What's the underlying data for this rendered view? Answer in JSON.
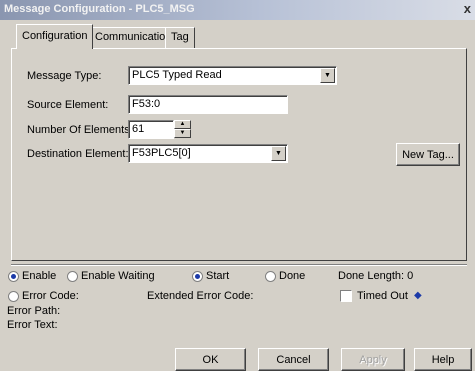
{
  "window": {
    "title": "Message Configuration - PLC5_MSG",
    "close_label": "x"
  },
  "tabs": [
    "Configuration",
    "Communication",
    "Tag"
  ],
  "config": {
    "message_type_label": "Message Type:",
    "message_type_value": "PLC5 Typed Read",
    "source_element_label": "Source Element:",
    "source_element_value": "F53:0",
    "num_elements_label": "Number Of Elements:",
    "num_elements_value": "61",
    "dest_element_label": "Destination Element:",
    "dest_element_value": "F53PLC5[0]",
    "new_tag_label": "New Tag..."
  },
  "status": {
    "enable_label": "Enable",
    "enable_waiting_label": "Enable Waiting",
    "start_label": "Start",
    "done_label": "Done",
    "done_length_label": "Done Length: 0",
    "error_code_label": "Error Code:",
    "extended_error_code_label": "Extended Error Code:",
    "timed_out_label": "Timed Out",
    "error_path_label": "Error Path:",
    "error_text_label": "Error Text:"
  },
  "buttons": {
    "ok": "OK",
    "cancel": "Cancel",
    "apply": "Apply",
    "help": "Help"
  }
}
